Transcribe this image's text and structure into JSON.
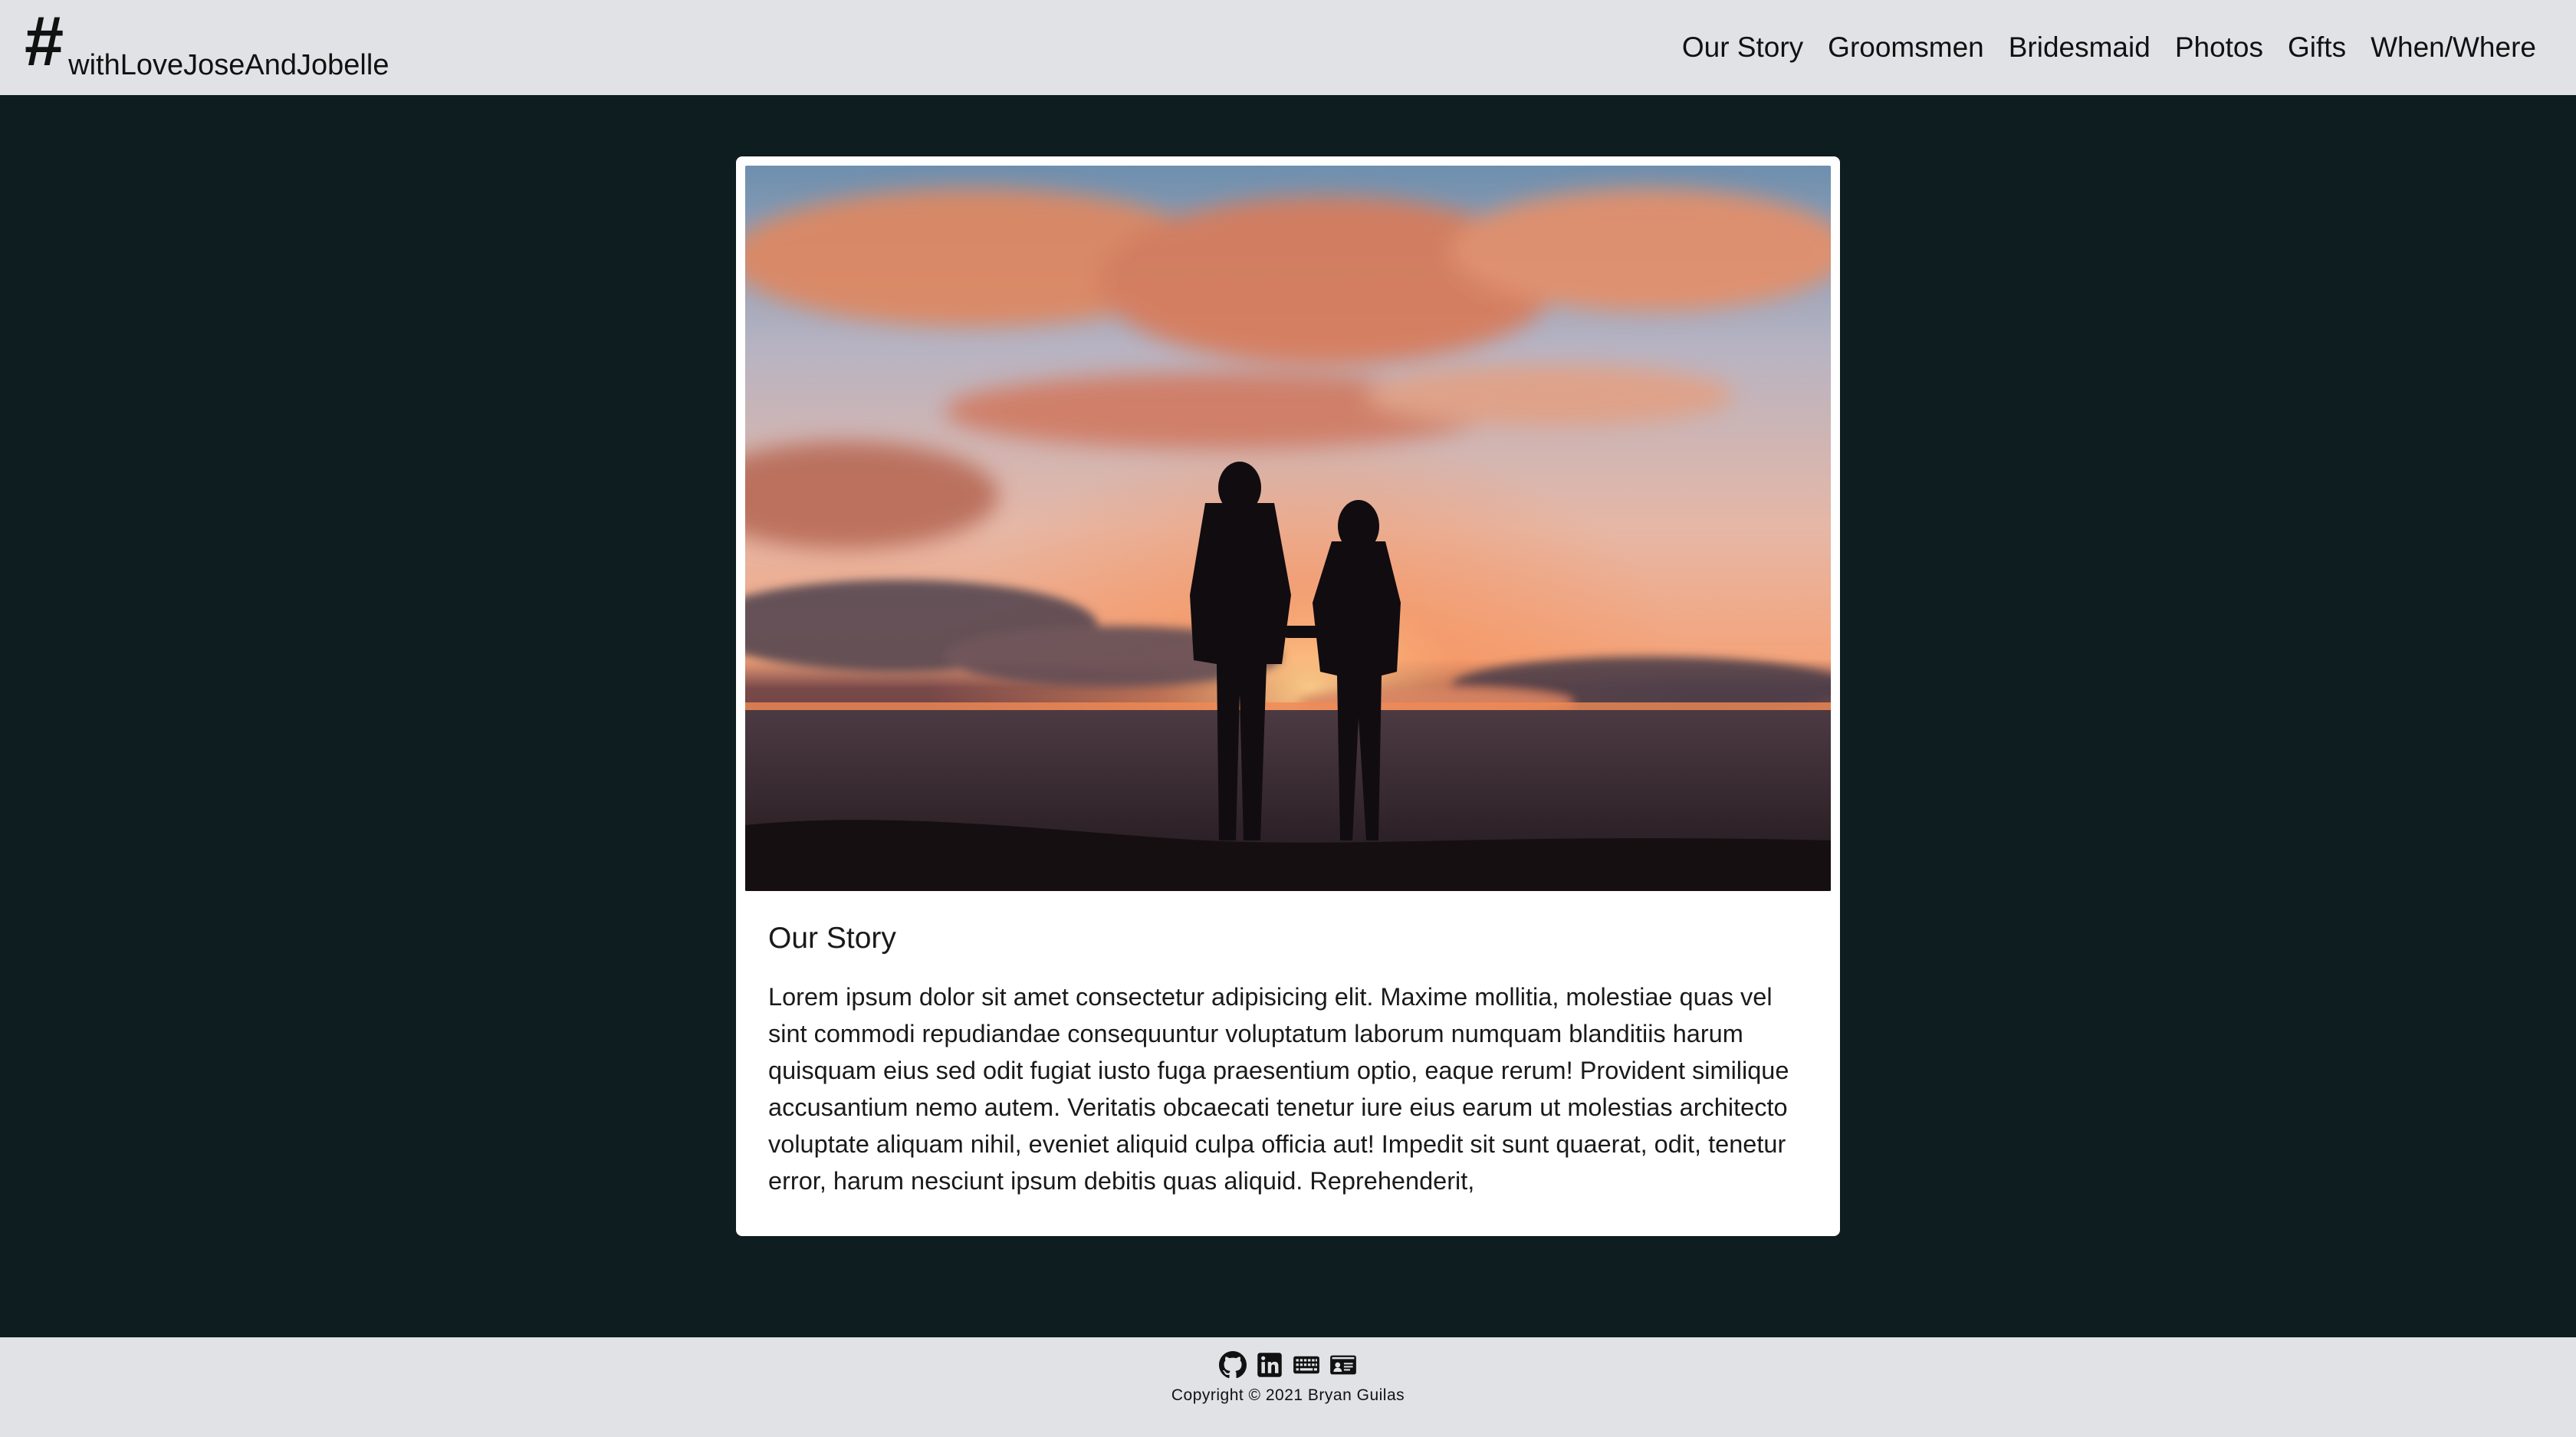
{
  "navbar": {
    "brand_hash": "#",
    "brand_text": "withLoveJoseAndJobelle",
    "links": [
      "Our Story",
      "Groomsmen",
      "Bridesmaid",
      "Photos",
      "Gifts",
      "When/Where"
    ]
  },
  "card": {
    "title": "Our Story",
    "text": "Lorem ipsum dolor sit amet consectetur adipisicing elit. Maxime mollitia, molestiae quas vel sint commodi repudiandae consequuntur voluptatum laborum numquam blanditiis harum quisquam eius sed odit fugiat iusto fuga praesentium optio, eaque rerum! Provident similique accusantium nemo autem. Veritatis obcaecati tenetur iure eius earum ut molestias architecto voluptate aliquam nihil, eveniet aliquid culpa officia aut! Impedit sit sunt quaerat, odit, tenetur error, harum nesciunt ipsum debitis quas aliquid. Reprehenderit,"
  },
  "footer": {
    "icons": [
      "github-icon",
      "linkedin-icon",
      "keyboard-icon",
      "id-card-icon"
    ],
    "copyright": "Copyright © 2021 Bryan Guilas"
  },
  "colors": {
    "page_background": "#0d1d20",
    "bar_background": "#e0e2e6",
    "card_background": "#ffffff"
  }
}
